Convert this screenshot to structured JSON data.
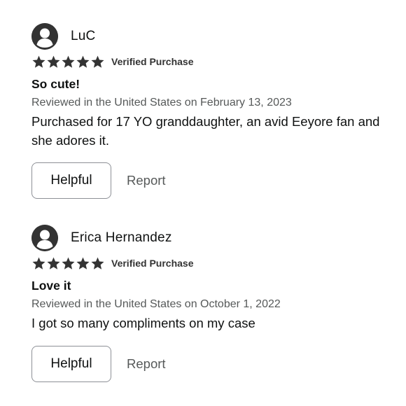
{
  "reviews": [
    {
      "profile_name": "LuC",
      "avatar_icon": "user-avatar-icon",
      "rating": 5,
      "rating_max": 5,
      "verified_label": "Verified Purchase",
      "title": "So cute!",
      "date_text": "Reviewed in the United States on February 13, 2023",
      "body": "Purchased for 17 YO granddaughter, an avid Eeyore fan and she adores it.",
      "helpful_label": "Helpful",
      "report_label": "Report"
    },
    {
      "profile_name": "Erica Hernandez",
      "avatar_icon": "user-avatar-icon",
      "rating": 5,
      "rating_max": 5,
      "verified_label": "Verified Purchase",
      "title": "Love it",
      "date_text": "Reviewed in the United States on October 1, 2022",
      "body": "I got so many compliments on my case",
      "helpful_label": "Helpful",
      "report_label": "Report"
    }
  ],
  "colors": {
    "star": "#333333",
    "text": "#0f1111",
    "muted": "#565959",
    "button_border": "#8d9096"
  }
}
